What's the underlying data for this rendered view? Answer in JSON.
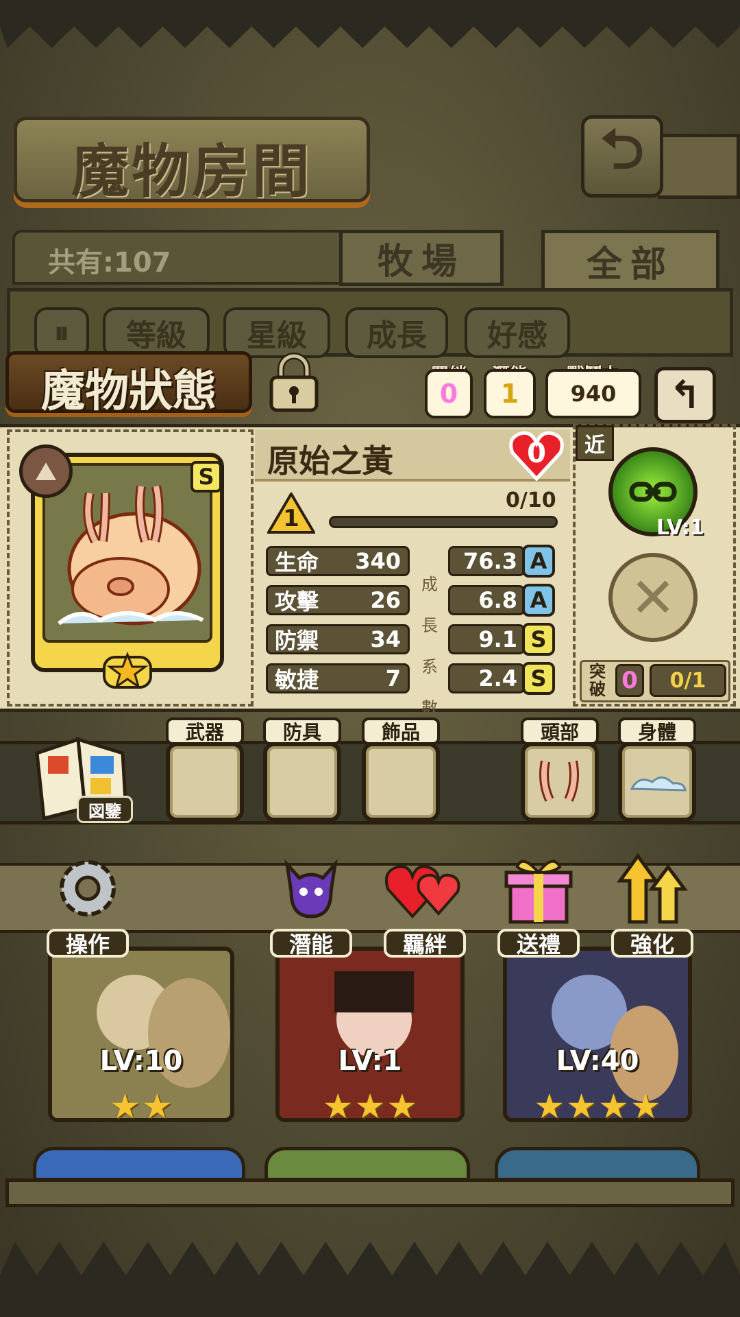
{
  "header": {
    "title": "魔物房間",
    "back_icon": "return-arrow-icon"
  },
  "collection": {
    "count_text": "共有:107"
  },
  "tabs": [
    {
      "label": "牧場"
    },
    {
      "label": "全部"
    }
  ],
  "filters": [
    {
      "label": "等級"
    },
    {
      "label": "星級"
    },
    {
      "label": "成長"
    },
    {
      "label": "好感"
    }
  ],
  "status": {
    "title": "魔物狀態",
    "bond": {
      "label": "羈絆",
      "value": "0"
    },
    "potential": {
      "label": "潛能",
      "value": "1"
    },
    "power": {
      "label": "戰鬥力",
      "value": "940"
    }
  },
  "monster": {
    "name": "原始之黃",
    "affection": "0",
    "rank": "S",
    "level": "1",
    "xp": "0/10",
    "xp_progress": 0,
    "stars": 1,
    "stats": [
      {
        "label": "生命",
        "value": "340",
        "growth": "76.3",
        "grade": "A"
      },
      {
        "label": "攻擊",
        "value": "26",
        "growth": "6.8",
        "grade": "A"
      },
      {
        "label": "防禦",
        "value": "34",
        "growth": "9.1",
        "grade": "S"
      },
      {
        "label": "敏捷",
        "value": "7",
        "growth": "2.4",
        "grade": "S"
      }
    ],
    "growth_label": [
      "成",
      "長",
      "系",
      "數"
    ]
  },
  "skills": {
    "range": "近",
    "skill_lv": "LV:1",
    "breakthrough_label": "突破",
    "breakthrough_value": "0",
    "breakthrough_count": "0/1"
  },
  "equipment": {
    "book_label": "図鑒",
    "slots": [
      {
        "label": "武器"
      },
      {
        "label": "防具"
      },
      {
        "label": "飾品"
      },
      {
        "label": "頭部"
      },
      {
        "label": "身體"
      }
    ]
  },
  "actions": [
    {
      "label": "操作",
      "icon": "gear-icon"
    },
    {
      "label": "潛能",
      "icon": "demon-icon"
    },
    {
      "label": "羈絆",
      "icon": "hearts-icon"
    },
    {
      "label": "送禮",
      "icon": "gift-icon"
    },
    {
      "label": "強化",
      "icon": "upgrade-arrows-icon"
    }
  ],
  "monster_list": [
    {
      "level": "LV:10",
      "stars": 2
    },
    {
      "level": "LV:1",
      "stars": 3
    },
    {
      "level": "LV:40",
      "stars": 4
    }
  ],
  "colors": {
    "bond": "#ff79e0",
    "potential": "#f5d04a",
    "card_gold": "#f5d64a"
  }
}
